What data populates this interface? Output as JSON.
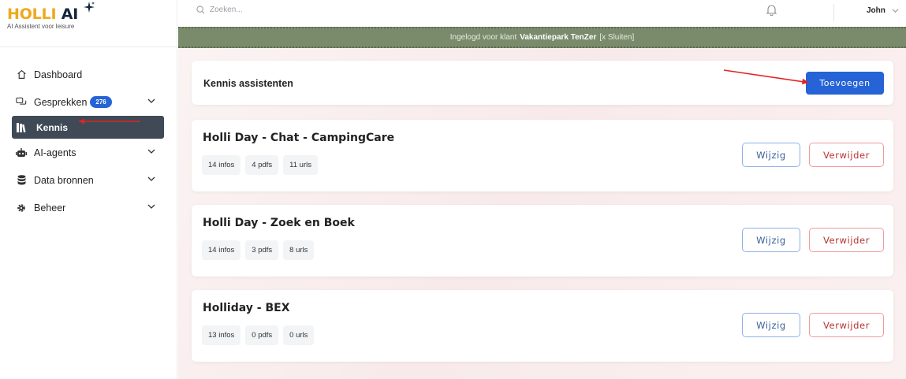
{
  "app": {
    "logo_part1": "HOLLI",
    "logo_part2": "AI",
    "tagline": "AI Assistent voor leisure"
  },
  "sidebar": {
    "items": [
      {
        "label": "Dashboard",
        "icon": "home-icon"
      },
      {
        "label": "Gesprekken",
        "icon": "chat-icon",
        "badge": "276",
        "has_chevron": true
      },
      {
        "label": "Kennis",
        "icon": "books-icon",
        "active": true
      },
      {
        "label": "AI-agents",
        "icon": "robot-icon",
        "has_chevron": true
      },
      {
        "label": "Data bronnen",
        "icon": "database-icon",
        "has_chevron": true
      },
      {
        "label": "Beheer",
        "icon": "gear-icon",
        "has_chevron": true
      }
    ]
  },
  "topbar": {
    "search_placeholder": "Zoeken...",
    "user_name": "John"
  },
  "banner": {
    "prefix": "Ingelogd voor klant",
    "client": "Vakantiepark TenZer",
    "close_label": "[x Sluiten]"
  },
  "main": {
    "header_title": "Kennis assistenten",
    "add_label": "Toevoegen",
    "edit_label": "Wijzig",
    "delete_label": "Verwijder",
    "assistants": [
      {
        "title": "Holli Day - Chat - CampingCare",
        "infos": "14 infos",
        "pdfs": "4 pdfs",
        "urls": "11 urls"
      },
      {
        "title": "Holli Day - Zoek en Boek",
        "infos": "14 infos",
        "pdfs": "3 pdfs",
        "urls": "8 urls"
      },
      {
        "title": "Holliday - BEX",
        "infos": "13 infos",
        "pdfs": "0 pdfs",
        "urls": "0 urls"
      }
    ]
  },
  "colors": {
    "primary": "#2563d6",
    "sidebar_active": "#3f4a56",
    "banner": "#7a8b6c",
    "annotation_arrow": "#e02424"
  }
}
